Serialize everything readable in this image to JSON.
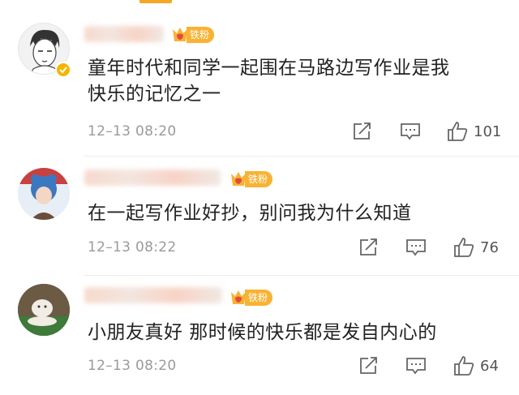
{
  "badge_label": "铁粉",
  "comments": [
    {
      "text_line1": "童年时代和同学一起围在马路边写作业是我",
      "text_line2": "快乐的记忆之一",
      "time": "12–13 08:20",
      "likes": "101",
      "verified": true
    },
    {
      "text": "在一起写作业好抄，别问我为什么知道",
      "time": "12–13 08:22",
      "likes": "76",
      "verified": false
    },
    {
      "text": "小朋友真好 那时候的快乐都是发自内心的",
      "time": "12–13 08:20",
      "likes": "64",
      "verified": false
    }
  ],
  "icons": {
    "share": "share-icon",
    "reply": "comment-icon",
    "like": "thumbs-up-icon",
    "badge": "fan-badge-icon",
    "verified": "verified-icon"
  },
  "colors": {
    "badge": "#f9b233",
    "verified": "#f7b500",
    "time": "#9a9a9a",
    "text": "#222222"
  }
}
